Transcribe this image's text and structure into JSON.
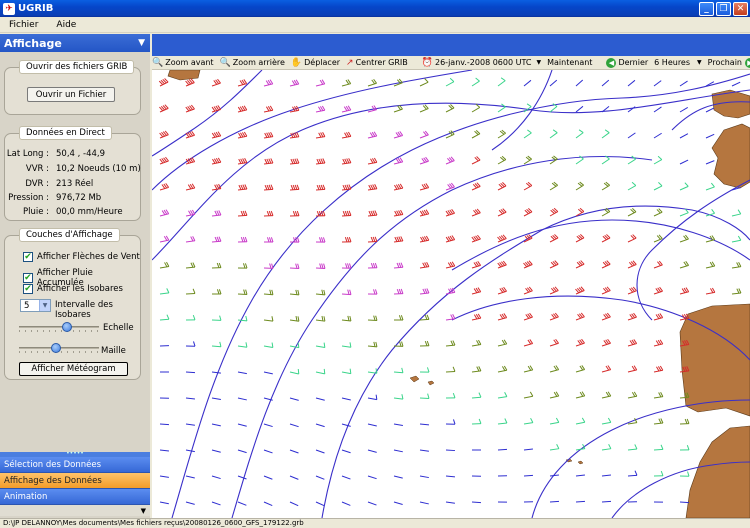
{
  "window": {
    "title": "UGRIB"
  },
  "menu": {
    "items": [
      "Fichier",
      "Aide"
    ]
  },
  "panel": {
    "title": "Affichage"
  },
  "grib_files": {
    "title": "Ouvrir des fichiers GRIB",
    "open_button": "Ouvrir un Fichier"
  },
  "live_data": {
    "title": "Données en Direct",
    "rows": [
      {
        "label": "Lat Long :",
        "value": "50,4 , -44,9"
      },
      {
        "label": "VVR :",
        "value": "10,2 Noeuds (10 m)"
      },
      {
        "label": "DVR :",
        "value": "213 Réel"
      },
      {
        "label": "Pression :",
        "value": "976,72 Mb"
      },
      {
        "label": "Pluie :",
        "value": "00,0 mm/Heure"
      }
    ]
  },
  "layers": {
    "title": "Couches d'Affichage",
    "checkboxes": [
      {
        "label": "Afficher Flèches de Vent",
        "checked": true
      },
      {
        "label": "Afficher Pluie Accumulée",
        "checked": true
      },
      {
        "label": "Afficher les Isobares",
        "checked": true
      }
    ],
    "isobar_interval": {
      "value": "5",
      "label": "Intervalle des Isobares"
    },
    "scale_label": "Echelle",
    "scale_level": 0.62,
    "mesh_label": "Maille",
    "mesh_level": 0.45,
    "meteogram_button": "Afficher Météogram"
  },
  "nav": {
    "tabs": [
      {
        "label": "Sélection des Données",
        "active": false
      },
      {
        "label": "Affichage des Données",
        "active": true
      },
      {
        "label": "Animation",
        "active": false
      }
    ]
  },
  "toolbar": {
    "zoom_in": "Zoom avant",
    "zoom_out": "Zoom arrière",
    "move": "Déplacer",
    "center": "Centrer GRIB",
    "datetime": "26-janv.-2008 0600 UTC",
    "now": "Maintenant",
    "last": "Dernier",
    "step": "6 Heures",
    "next": "Prochain"
  },
  "status": {
    "text": "D:\\JP DELANNOY\\Mes documents\\Mes fichiers reçus\\20080126_0600_GFS_179122.grb"
  },
  "colors": {
    "isobar": "#3a2fc9",
    "land": "#b5763f",
    "accent": "#2c5cd0"
  }
}
